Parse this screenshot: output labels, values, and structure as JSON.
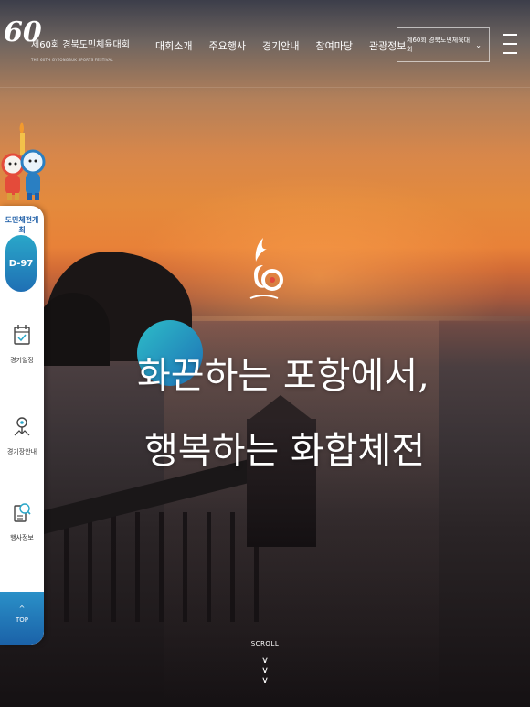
{
  "header": {
    "logo_number": "60",
    "logo_title": "제60회 경북도민체육대회",
    "logo_subtitle": "THE 60TH GYEONGBUK SPORTS FESTIVAL",
    "nav": [
      "대회소개",
      "주요행사",
      "경기안내",
      "참여마당",
      "관광정보"
    ],
    "event_select": "제60회 경북도민체육대회",
    "event_select_icon": "chevron-down-icon",
    "menu_icon": "hamburger-icon"
  },
  "side": {
    "dday_label": "도민체전개최",
    "dday_value": "D-97",
    "items": [
      {
        "label": "경기일정",
        "icon": "calendar-icon"
      },
      {
        "label": "경기장안내",
        "icon": "map-pin-icon"
      },
      {
        "label": "행사정보",
        "icon": "info-search-icon"
      }
    ],
    "top_caret": "^",
    "top_label": "TOP"
  },
  "hero": {
    "slogan_line1": "화끈하는 포항에서,",
    "slogan_line2": "행복하는 화합체전",
    "scroll_label": "SCROLL"
  },
  "colors": {
    "accent_blue": "#1f6fb4",
    "accent_teal": "#2aa7c9"
  }
}
